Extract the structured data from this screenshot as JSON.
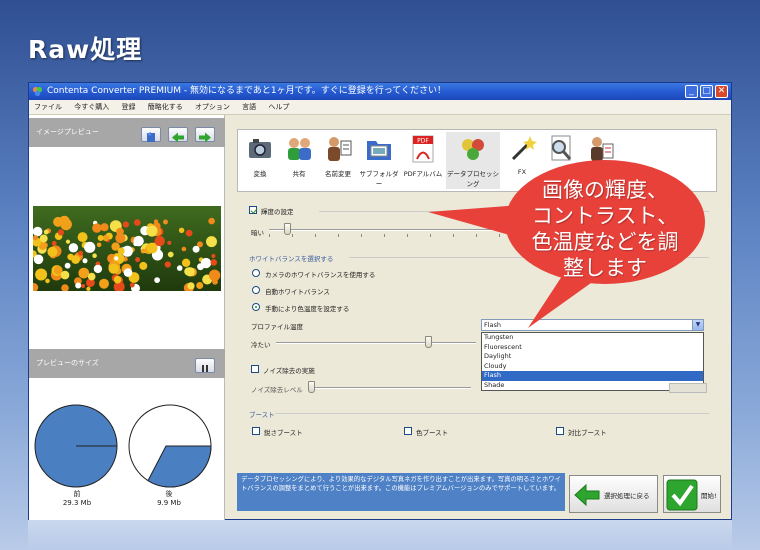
{
  "slide": {
    "title": "Raw処理"
  },
  "window": {
    "title": "Contenta Converter PREMIUM - 無効になるまであと1ヶ月です。すぐに登録を行ってください！",
    "buttons": {
      "minimize": "_",
      "maximize": "□",
      "close": "✕"
    }
  },
  "menu": [
    "ファイル",
    "今すぐ購入",
    "登録",
    "簡略化する",
    "オプション",
    "言語",
    "ヘルプ"
  ],
  "left_panel": {
    "preview_header": "イメージプレビュー",
    "size_header": "プレビューのサイズ",
    "before": {
      "label": "前",
      "size": "29.3 Mb",
      "fraction": 0.25
    },
    "after": {
      "label": "後",
      "size": "9.9 Mb",
      "fraction": 0.34
    }
  },
  "toolbar": {
    "items": [
      {
        "label": "変換",
        "icon": "camera-icon"
      },
      {
        "label": "共有",
        "icon": "users-icon"
      },
      {
        "label": "名前変更",
        "icon": "person-rename-icon"
      },
      {
        "label": "サブフォルダー",
        "icon": "folder-icon"
      },
      {
        "label": "PDFアルバム",
        "icon": "pdf-icon"
      },
      {
        "label": "データプロセッシング",
        "icon": "color-balls-icon"
      },
      {
        "label": "FX",
        "icon": "magic-wand-icon"
      },
      {
        "label": "",
        "icon": "magnifier-doc-icon"
      },
      {
        "label": "",
        "icon": "person-doc-icon"
      }
    ],
    "active_index": 5
  },
  "brightness": {
    "checkbox_label": "輝度の設定",
    "checked": true,
    "dark_label": "暗い",
    "value": 0.08
  },
  "white_balance": {
    "group_label": "ホワイトバランスを選択する",
    "options": [
      "カメラのホワイトバランスを使用する",
      "自動ホワイトバランス",
      "手動により色温度を設定する"
    ],
    "selected_index": 2,
    "profile_label": "プロファイル温度",
    "profile_value": "Flash",
    "dropdown_options": [
      "Tungsten",
      "Fluorescent",
      "Daylight",
      "Cloudy",
      "Flash",
      "Shade"
    ],
    "dropdown_selected": 4,
    "cool_label": "冷たい",
    "temp_value": 0.76
  },
  "noise": {
    "checkbox_label": "ノイズ除去の実施",
    "checked": false,
    "level_label": "ノイズ除去レベル",
    "value": 0.0
  },
  "boost": {
    "group_label": "ブースト",
    "items": [
      "鋭さブースト",
      "色ブースト",
      "対比ブースト"
    ]
  },
  "info_text": "データプロセッシングにより、より効果的なデジタル写真ネガを作り出すことが出来ます。写真の明るさとホワイトバランスの調整をまとめて行うことが出来ます。この機能はプレミアムバージョンのみでサポートしています。",
  "buttons": {
    "back": "選択処理に戻る",
    "start": "開始!"
  },
  "callout": {
    "lines": [
      "画像の輝度、",
      "コントラスト、",
      "色温度などを調",
      "整します"
    ],
    "color": "#e8413a"
  }
}
